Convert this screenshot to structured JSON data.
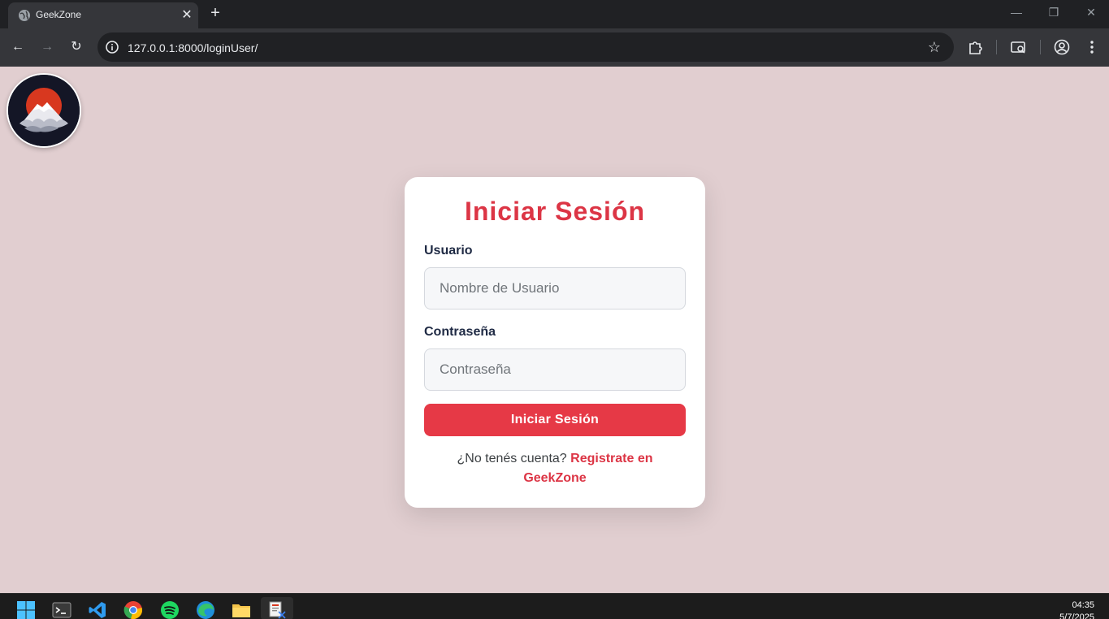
{
  "browser": {
    "tab_title": "GeekZone",
    "url": "127.0.0.1:8000/loginUser/"
  },
  "page": {
    "background": "#e1ced0",
    "accent": "#dc3545",
    "logo": "mount-fuji-red-sun-logo"
  },
  "login": {
    "title": "Iniciar Sesión",
    "username_label": "Usuario",
    "username_placeholder": "Nombre de Usuario",
    "password_label": "Contraseña",
    "password_placeholder": "Contraseña",
    "submit_label": "Iniciar Sesión",
    "register_prompt": "¿No tenés cuenta?",
    "register_link": "Registrate en GeekZone"
  },
  "taskbar": {
    "apps": [
      "windows-start-icon",
      "terminal-icon",
      "vscode-icon",
      "chrome-icon",
      "spotify-icon",
      "edge-icon",
      "file-explorer-icon",
      "app-icon"
    ],
    "time": "04:35",
    "date": "5/7/2025"
  }
}
